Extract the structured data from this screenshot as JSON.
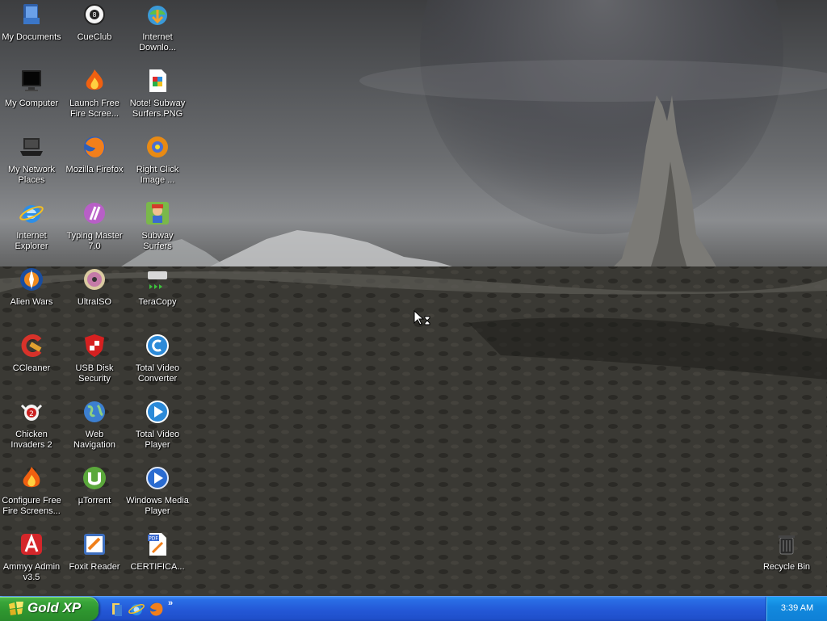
{
  "desktop": {
    "icons": [
      {
        "name": "my-documents",
        "label": "My Documents"
      },
      {
        "name": "my-computer",
        "label": "My Computer"
      },
      {
        "name": "my-network-places",
        "label": "My Network\nPlaces"
      },
      {
        "name": "internet-explorer",
        "label": "Internet\nExplorer"
      },
      {
        "name": "alien-wars",
        "label": "Alien Wars"
      },
      {
        "name": "ccleaner",
        "label": "CCleaner"
      },
      {
        "name": "chicken-invaders-2",
        "label": "Chicken\nInvaders 2"
      },
      {
        "name": "configure-free-fire-screensaver",
        "label": "Configure Free\nFire Screens..."
      },
      {
        "name": "ammyy-admin",
        "label": "Ammyy Admin\nv3.5"
      },
      {
        "name": "cueclub",
        "label": "CueClub"
      },
      {
        "name": "launch-free-fire-screensaver",
        "label": "Launch Free\nFire Scree..."
      },
      {
        "name": "mozilla-firefox",
        "label": "Mozilla Firefox"
      },
      {
        "name": "typing-master",
        "label": "Typing Master\n7.0"
      },
      {
        "name": "ultraiso",
        "label": "UltraISO"
      },
      {
        "name": "usb-disk-security",
        "label": "USB Disk\nSecurity"
      },
      {
        "name": "web-navigation",
        "label": "Web\nNavigation"
      },
      {
        "name": "utorrent",
        "label": "µTorrent"
      },
      {
        "name": "foxit-reader",
        "label": "Foxit Reader"
      },
      {
        "name": "internet-download-manager",
        "label": "Internet\nDownlo..."
      },
      {
        "name": "subway-surfers-png",
        "label": "Note! Subway\nSurfers.PNG"
      },
      {
        "name": "right-click-image",
        "label": "Right Click\nImage ..."
      },
      {
        "name": "subway-surfers",
        "label": "Subway\nSurfers"
      },
      {
        "name": "teracopy",
        "label": "TeraCopy"
      },
      {
        "name": "total-video-converter",
        "label": "Total Video\nConverter"
      },
      {
        "name": "total-video-player",
        "label": "Total Video\nPlayer"
      },
      {
        "name": "windows-media-player",
        "label": "Windows Media\nPlayer"
      },
      {
        "name": "certificate-pdf",
        "label": "CERTIFICA..."
      },
      {
        "name": "recycle-bin",
        "label": "Recycle Bin"
      }
    ]
  },
  "taskbar": {
    "start_label": "Gold XP",
    "quick_launch": [
      "show-desktop-icon",
      "internet-explorer-icon",
      "firefox-icon"
    ],
    "clock": "3:39 AM"
  }
}
